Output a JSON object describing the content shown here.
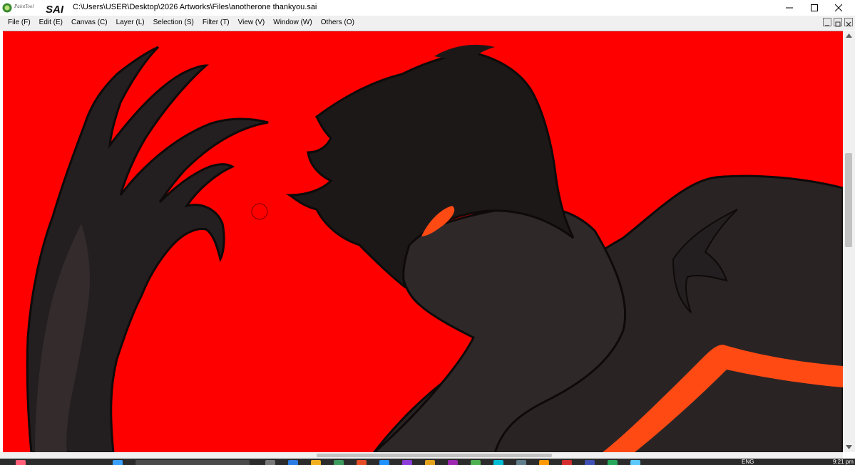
{
  "app": {
    "logo_small_text": "PaintTool",
    "logo_big_text": "SAI",
    "window_title": "C:\\Users\\USER\\Desktop\\2026 Artworks\\Files\\anotherone thankyou.sai"
  },
  "window_controls": {
    "minimize_icon": "minimize-icon",
    "maximize_icon": "maximize-icon",
    "close_icon": "close-icon"
  },
  "menu": {
    "items": [
      {
        "label": "File (F)"
      },
      {
        "label": "Edit (E)"
      },
      {
        "label": "Canvas (C)"
      },
      {
        "label": "Layer (L)"
      },
      {
        "label": "Selection (S)"
      },
      {
        "label": "Filter (T)"
      },
      {
        "label": "View (V)"
      },
      {
        "label": "Window (W)"
      },
      {
        "label": "Others (O)"
      }
    ]
  },
  "colors": {
    "canvas_background": "#ff0000",
    "silhouette": "#231e1f",
    "silhouette_shade": "#332b2c",
    "accent_orange": "#ff4a14",
    "menubar": "#f0f0f0"
  },
  "canvas": {
    "brush_cursor": "brush-cursor-circle"
  },
  "taskbar": {
    "language": "ENG",
    "time": "9:21 pm"
  }
}
